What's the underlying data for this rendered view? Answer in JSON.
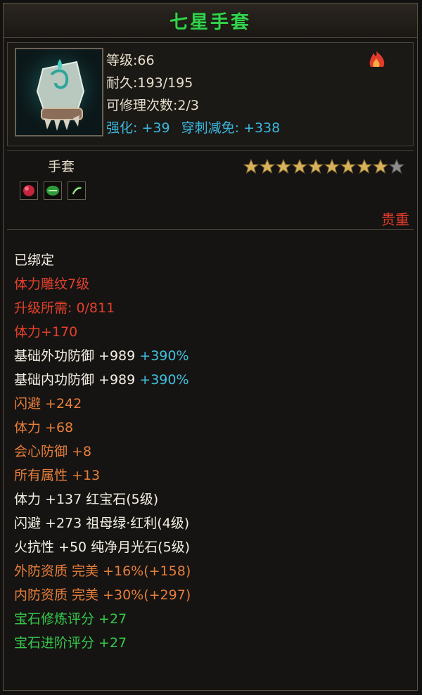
{
  "item": {
    "name": "七星手套",
    "level": "等级:66",
    "durability": "耐久:193/195",
    "repairs": "可修理次数:2/3",
    "enhance": "强化: +39",
    "pierce_reduction": "穿刺减免: +338",
    "type": "手套",
    "rarity": "贵重",
    "stars_filled": 9,
    "stars_total": 10
  },
  "attributes": {
    "bound": "已绑定",
    "engrave": "体力雕纹7级",
    "upgrade": "升级所需: 0/811",
    "stamina_bonus": "体力+170",
    "ext_def_base": "基础外功防御 +989",
    "ext_def_pct": "+390%",
    "int_def_base": "基础内功防御 +989",
    "int_def_pct": "+390%",
    "dodge": "闪避 +242",
    "stamina": "体力 +68",
    "crit_def": "会心防御 +8",
    "all_attr": "所有属性 +13",
    "gem1": "体力 +137 红宝石(5级)",
    "gem2": "闪避 +273 祖母绿·红利(4级)",
    "gem3": "火抗性 +50 纯净月光石(5级)",
    "ext_quality": "外防资质 完美 +16%(+158)",
    "int_quality": "内防资质 完美 +30%(+297)",
    "gem_refine": "宝石修炼评分 +27",
    "gem_advance": "宝石进阶评分 +27"
  },
  "colors": {
    "title": "#33d24b",
    "enhance": "#39b8df",
    "red": "#e2402b",
    "orange": "#e87e3a",
    "green": "#36c94a"
  },
  "icons": {
    "item_icon": "gauntlet-icon",
    "flame_icon": "flame-icon",
    "gem_icons": [
      "ruby-gem-icon",
      "emerald-gem-icon",
      "moonstone-gem-icon"
    ]
  }
}
